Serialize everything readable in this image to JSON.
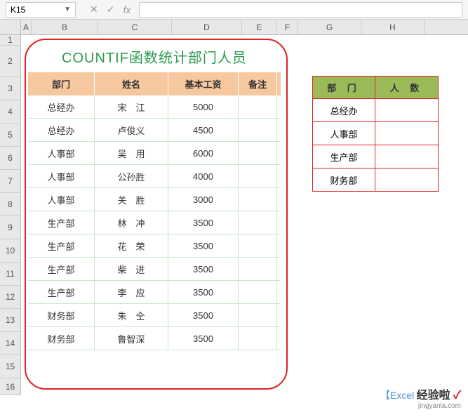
{
  "nameBox": "K15",
  "formulaBar": {
    "cancel": "✕",
    "confirm": "✓",
    "fx": "fx"
  },
  "columns": [
    "A",
    "B",
    "C",
    "D",
    "E",
    "F",
    "G",
    "H"
  ],
  "rows": [
    "1",
    "2",
    "3",
    "4",
    "5",
    "6",
    "7",
    "8",
    "9",
    "10",
    "11",
    "12",
    "13",
    "14",
    "15",
    "16"
  ],
  "title": "COUNTIF函数统计部门人员",
  "mainHeaders": {
    "dept": "部门",
    "name": "姓名",
    "salary": "基本工资",
    "note": "备注"
  },
  "mainData": [
    {
      "dept": "总经办",
      "name": "宋　江",
      "salary": "5000",
      "note": ""
    },
    {
      "dept": "总经办",
      "name": "卢俊义",
      "salary": "4500",
      "note": ""
    },
    {
      "dept": "人事部",
      "name": "吴　用",
      "salary": "6000",
      "note": ""
    },
    {
      "dept": "人事部",
      "name": "公孙胜",
      "salary": "4000",
      "note": ""
    },
    {
      "dept": "人事部",
      "name": "关　胜",
      "salary": "3000",
      "note": ""
    },
    {
      "dept": "生产部",
      "name": "林　冲",
      "salary": "3500",
      "note": ""
    },
    {
      "dept": "生产部",
      "name": "花　荣",
      "salary": "3500",
      "note": ""
    },
    {
      "dept": "生产部",
      "name": "柴　进",
      "salary": "3500",
      "note": ""
    },
    {
      "dept": "生产部",
      "name": "李　应",
      "salary": "3500",
      "note": ""
    },
    {
      "dept": "财务部",
      "name": "朱　仝",
      "salary": "3500",
      "note": ""
    },
    {
      "dept": "财务部",
      "name": "鲁智深",
      "salary": "3500",
      "note": ""
    }
  ],
  "sideHeaders": {
    "dept": "部 门",
    "count": "人 数"
  },
  "sideData": [
    {
      "dept": "总经办",
      "count": ""
    },
    {
      "dept": "人事部",
      "count": ""
    },
    {
      "dept": "生产部",
      "count": ""
    },
    {
      "dept": "财务部",
      "count": ""
    }
  ],
  "watermark": {
    "excel": "【Excel",
    "logo": "经验啦",
    "check": "✓",
    "url": "jingyanla.com"
  }
}
